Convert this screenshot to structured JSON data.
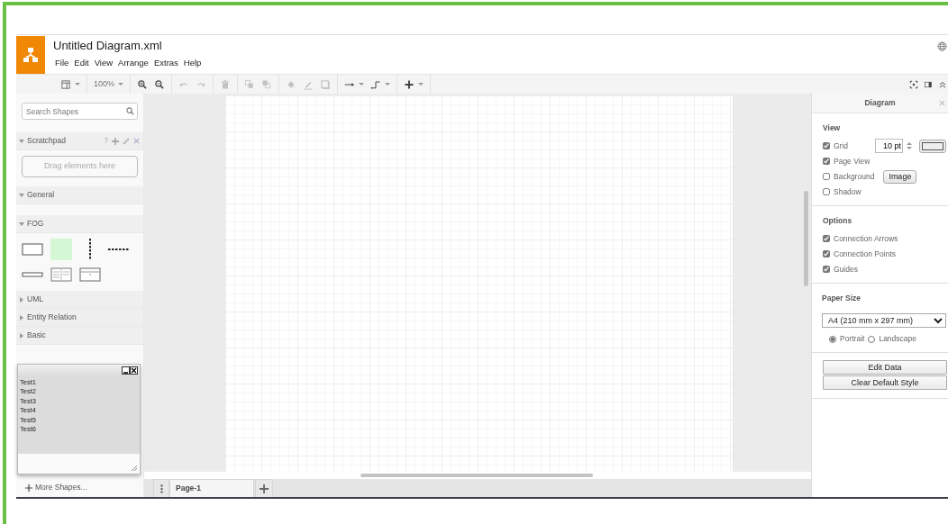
{
  "app": {
    "title": "Untitled Diagram.xml",
    "menus": [
      "File",
      "Edit",
      "View",
      "Arrange",
      "Extras",
      "Help"
    ]
  },
  "toolbar": {
    "groups": [
      [
        {
          "kind": "layout",
          "caret": true,
          "disabled": false
        }
      ],
      [
        {
          "kind": "zoom",
          "label": "100%",
          "caret": true,
          "disabled": false
        }
      ],
      [
        {
          "kind": "zoom-in",
          "caret": false,
          "disabled": false
        },
        {
          "kind": "zoom-out",
          "caret": false,
          "disabled": false
        }
      ],
      [
        {
          "kind": "undo",
          "caret": false,
          "disabled": true
        },
        {
          "kind": "redo",
          "caret": false,
          "disabled": true
        }
      ],
      [
        {
          "kind": "delete",
          "caret": false,
          "disabled": true
        }
      ],
      [
        {
          "kind": "to-front",
          "caret": false,
          "disabled": true
        },
        {
          "kind": "to-back",
          "caret": false,
          "disabled": true
        }
      ],
      [
        {
          "kind": "fill",
          "caret": false,
          "disabled": true
        },
        {
          "kind": "line",
          "caret": false,
          "disabled": true
        },
        {
          "kind": "shadow",
          "caret": false,
          "disabled": true
        }
      ],
      [
        {
          "kind": "connection",
          "caret": true,
          "disabled": false
        },
        {
          "kind": "waypoint",
          "caret": true,
          "disabled": false
        }
      ],
      [
        {
          "kind": "insert",
          "caret": true,
          "disabled": false
        }
      ]
    ],
    "right": [
      {
        "kind": "fullscreen"
      },
      {
        "kind": "format"
      },
      {
        "kind": "collapse"
      }
    ]
  },
  "sidebar": {
    "search": {
      "placeholder": "Search Shapes"
    },
    "scratchpad": {
      "title": "Scratchpad",
      "expanded": true,
      "help": "?",
      "drop_hint": "Drag elements here"
    },
    "sections": [
      {
        "title": "General",
        "expanded": true
      },
      {
        "title": "FOG",
        "expanded": true,
        "shapes": [
          {
            "kind": "rectangle"
          },
          {
            "kind": "filled-square"
          },
          {
            "kind": "vertical-dashed"
          },
          {
            "kind": "horizontal-dashed"
          },
          {
            "kind": "thin-bar"
          },
          {
            "kind": "table"
          },
          {
            "kind": "header-box"
          }
        ]
      },
      {
        "title": "UML",
        "expanded": false
      },
      {
        "title": "Entity Relation",
        "expanded": false
      },
      {
        "title": "Basic",
        "expanded": false
      }
    ],
    "more_shapes": "More Shapes..."
  },
  "floating_window": {
    "items": [
      "Test1",
      "Test2",
      "Test3",
      "Test4",
      "Test5",
      "Test6"
    ]
  },
  "page_tabs": [
    {
      "label": "Page-1",
      "selected": true
    }
  ],
  "format_panel": {
    "title": "Diagram",
    "sections": [
      {
        "heading": "View",
        "options": [
          {
            "kind": "grid",
            "label": "Grid",
            "checked": true,
            "value": "10 pt"
          },
          {
            "kind": "plain",
            "label": "Page View",
            "checked": true
          },
          {
            "kind": "image",
            "label": "Background",
            "checked": false,
            "button": "Image"
          },
          {
            "kind": "plain",
            "label": "Shadow",
            "checked": false
          }
        ]
      },
      {
        "heading": "Options",
        "options": [
          {
            "kind": "plain",
            "label": "Connection Arrows",
            "checked": true
          },
          {
            "kind": "plain",
            "label": "Connection Points",
            "checked": true
          },
          {
            "kind": "plain",
            "label": "Guides",
            "checked": true
          }
        ]
      }
    ],
    "paper": {
      "heading": "Paper Size",
      "value": "A4 (210 mm x 297 mm)",
      "orientations": [
        {
          "label": "Portrait",
          "selected": true
        },
        {
          "label": "Landscape",
          "selected": false
        }
      ]
    },
    "buttons": [
      "Edit Data",
      "Clear Default Style"
    ]
  }
}
